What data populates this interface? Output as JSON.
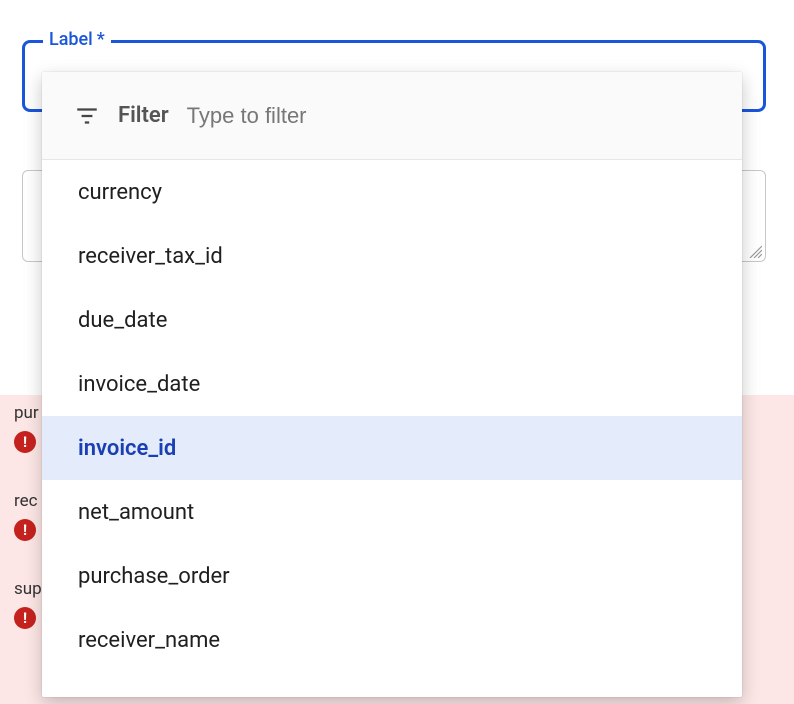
{
  "colors": {
    "accent": "#1a56db",
    "selected_bg": "#e4ecfb",
    "selected_fg": "#1a3fb3",
    "error_bg": "#fde7e6",
    "error_icon": "#c5221f"
  },
  "labelField": {
    "legend": "Label",
    "required_marker": "*",
    "value": ""
  },
  "secondField": {
    "value": ""
  },
  "errorItems": [
    {
      "text": "pur"
    },
    {
      "text": "rec"
    },
    {
      "text": "sup"
    }
  ],
  "dropdown": {
    "filterLabel": "Filter",
    "filterPlaceholder": "Type to filter",
    "options": [
      {
        "label": "currency",
        "selected": false
      },
      {
        "label": "receiver_tax_id",
        "selected": false
      },
      {
        "label": "due_date",
        "selected": false
      },
      {
        "label": "invoice_date",
        "selected": false
      },
      {
        "label": "invoice_id",
        "selected": true
      },
      {
        "label": "net_amount",
        "selected": false
      },
      {
        "label": "purchase_order",
        "selected": false
      },
      {
        "label": "receiver_name",
        "selected": false
      }
    ]
  }
}
